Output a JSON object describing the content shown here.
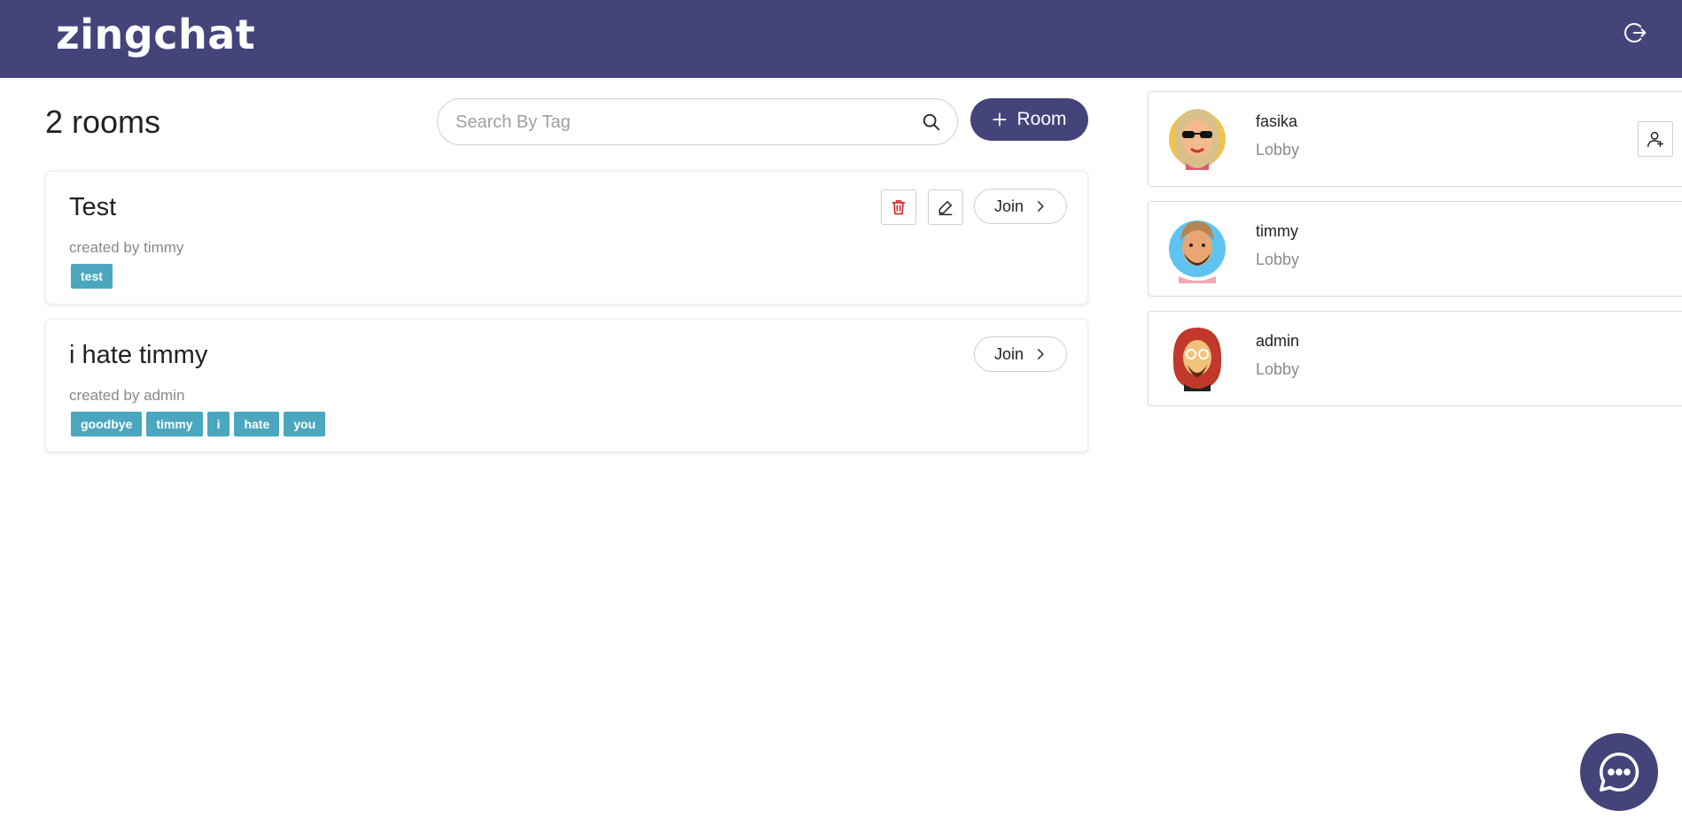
{
  "app": {
    "brand": "zingchat"
  },
  "header": {
    "logout_icon": "logout-icon"
  },
  "rooms": {
    "count_label": "2 rooms",
    "search_placeholder": "Search By Tag",
    "add_room_label": "Room",
    "items": [
      {
        "title": "Test",
        "created_by": "created by timmy",
        "tags": [
          "test"
        ],
        "can_edit": true,
        "join_label": "Join"
      },
      {
        "title": "i hate timmy",
        "created_by": "created by admin",
        "tags": [
          "goodbye",
          "timmy",
          "i",
          "hate",
          "you"
        ],
        "can_edit": false,
        "join_label": "Join"
      }
    ]
  },
  "users": [
    {
      "name": "fasika",
      "status": "Lobby",
      "avatar_bg": "#f2c24b",
      "hair": "#d9c08a",
      "skin": "#f4b98c",
      "show_add_friend": true
    },
    {
      "name": "timmy",
      "status": "Lobby",
      "avatar_bg": "#5fc3ef",
      "hair": "#b5854f",
      "skin": "#e9a673",
      "show_add_friend": false
    },
    {
      "name": "admin",
      "status": "Lobby",
      "avatar_bg": "#ffffff",
      "hair": "#c0392b",
      "skin": "#f0c27b",
      "show_add_friend": false
    }
  ],
  "colors": {
    "primary": "#44437a",
    "tag": "#4aa7bf",
    "delete": "#d32f2f"
  }
}
